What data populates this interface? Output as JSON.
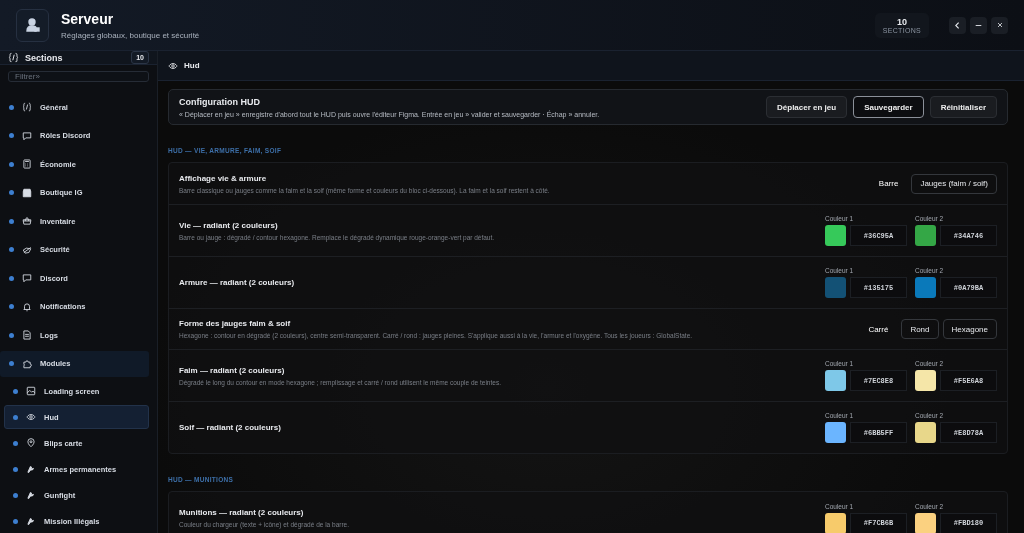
{
  "header": {
    "title": "Serveur",
    "subtitle": "Réglages globaux, boutique et sécurité",
    "count": {
      "value": "10",
      "label": "SECTIONS"
    }
  },
  "sidebar": {
    "title": "Sections",
    "count": "10",
    "filter": {
      "placeholder": "Filtrer»"
    },
    "items": [
      {
        "label": "Général",
        "selected": false
      },
      {
        "label": "Rôles Discord",
        "selected": false
      },
      {
        "label": "Économie",
        "selected": false
      },
      {
        "label": "Boutique IG",
        "selected": false
      },
      {
        "label": "Inventaire",
        "selected": false
      },
      {
        "label": "Sécurité",
        "selected": false
      },
      {
        "label": "Discord",
        "selected": false
      },
      {
        "label": "Notifications",
        "selected": false
      },
      {
        "label": "Logs",
        "selected": false
      },
      {
        "label": "Modules",
        "selected": false,
        "expanded": true,
        "children": [
          {
            "label": "Loading screen",
            "selected": false
          },
          {
            "label": "Hud",
            "selected": true
          },
          {
            "label": "Blips carte",
            "selected": false
          },
          {
            "label": "Armes permanentes",
            "selected": false
          },
          {
            "label": "Gunfight",
            "selected": false
          },
          {
            "label": "Mission Illégals",
            "selected": false
          }
        ]
      }
    ]
  },
  "panel": {
    "title": "Hud",
    "config": {
      "title": "Configuration HUD",
      "text": "« Déplacer en jeu » enregistre d'abord tout le HUD puis ouvre l'éditeur Figma. Entrée en jeu » valider et sauvegarder · Échap » annuler.",
      "buttons": [
        {
          "label": "Déplacer en jeu",
          "kind": "plain"
        },
        {
          "label": "Sauvegarder",
          "kind": "primary"
        },
        {
          "label": "Réinitialiser",
          "kind": "plain"
        }
      ]
    },
    "sections": [
      {
        "title": "HUD — VIE, ARMURE, FAIM, SOIF",
        "rows": [
          {
            "kind": "segmented",
            "title": "Affichage vie & armure",
            "description": "Barre classique ou jauges comme la faim et la soif (même forme et couleurs du bloc ci-dessous). La faim et la soif restent à côté.",
            "options": [
              {
                "label": "Barre",
                "selected": true
              },
              {
                "label": "Jauges (faim / soif)",
                "selected": false
              }
            ]
          },
          {
            "kind": "colors",
            "title": "Vie — radiant (2 couleurs)",
            "description": "Barre ou jauge : dégradé / contour hexagone. Remplace le dégradé dynamique rouge-orange-vert par défaut.",
            "colors": [
              {
                "label": "Couleur 1",
                "value": "#36C95A",
                "color": "#36c95a"
              },
              {
                "label": "Couleur 2",
                "value": "#34A746",
                "color": "#34a746"
              }
            ]
          },
          {
            "kind": "colors",
            "title": "Armure — radiant (2 couleurs)",
            "colors": [
              {
                "label": "Couleur 1",
                "value": "#135175",
                "color": "#135175"
              },
              {
                "label": "Couleur 2",
                "value": "#0A79BA",
                "color": "#0a79ba"
              }
            ]
          },
          {
            "kind": "segmented",
            "title": "Forme des jauges faim & soif",
            "description": "Hexagone : contour en dégradé (2 couleurs), centre semi-transparent. Carré / rond : jauges pleines. S'applique aussi à la vie, l'armure et l'oxygène. Tous les joueurs : GlobalState.",
            "options": [
              {
                "label": "Carré",
                "selected": true
              },
              {
                "label": "Rond",
                "selected": false
              },
              {
                "label": "Hexagone",
                "selected": false
              }
            ]
          },
          {
            "kind": "colors",
            "title": "Faim — radiant (2 couleurs)",
            "description": "Dégradé le long du contour en mode hexagone ; remplissage et carré / rond utilisent le même couple de teintes.",
            "colors": [
              {
                "label": "Couleur 1",
                "value": "#7EC8E8",
                "color": "#7ec8e8"
              },
              {
                "label": "Couleur 2",
                "value": "#F5E6A8",
                "color": "#f5e6a8"
              }
            ]
          },
          {
            "kind": "colors",
            "title": "Soif — radiant (2 couleurs)",
            "colors": [
              {
                "label": "Couleur 1",
                "value": "#6BB5FF",
                "color": "#6bb5ff"
              },
              {
                "label": "Couleur 2",
                "value": "#E8D78A",
                "color": "#e8d78a"
              }
            ]
          }
        ]
      },
      {
        "title": "HUD — MUNITIONS",
        "rows": [
          {
            "kind": "colors",
            "title": "Munitions — radiant (2 couleurs)",
            "description": "Couleur du chargeur (texte + icône) et dégradé de la barre.",
            "colors": [
              {
                "label": "Couleur 1",
                "value": "#F7CB6B",
                "color": "#f7cb6b"
              },
              {
                "label": "Couleur 2",
                "value": "#FBD180",
                "color": "#fbd180"
              }
            ]
          }
        ]
      }
    ]
  }
}
